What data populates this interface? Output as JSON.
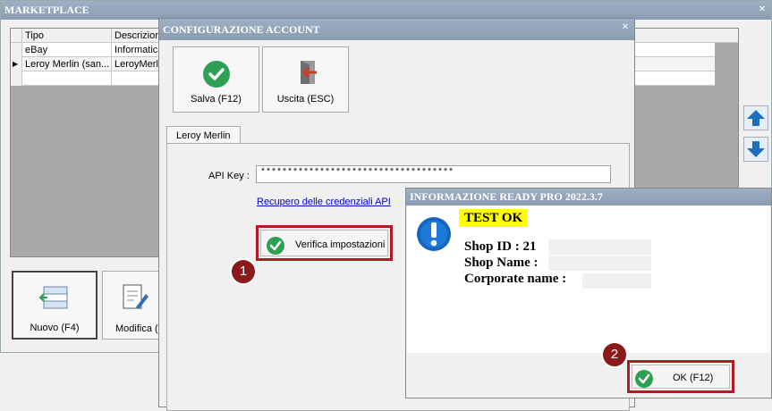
{
  "marketplace": {
    "title": "MARKETPLACE",
    "close": "×",
    "columns": [
      "Tipo",
      "Descrizione"
    ],
    "rows": [
      {
        "tipo": "eBay",
        "desc": "Informatica"
      },
      {
        "tipo": "Leroy Merlin (san...",
        "desc": "LeroyMerlin"
      }
    ],
    "row_indicator": "▶",
    "toolbar": {
      "new_label": "Nuovo (F4)",
      "edit_label": "Modifica (F"
    }
  },
  "config": {
    "title": "CONFIGURAZIONE ACCOUNT",
    "close": "×",
    "save_label": "Salva (F12)",
    "exit_label": "Uscita (ESC)",
    "tab_label": "Leroy Merlin",
    "api_key_label": "API Key :",
    "api_key_value": "************************************",
    "recover_link": "Recupero delle credenziali API",
    "verify_label": "Verifica impostazioni"
  },
  "info": {
    "title": "INFORMAZIONE READY PRO 2022.3.7",
    "test_result": "TEST OK",
    "shop_id": "Shop ID : 21",
    "shop_name": "Shop Name :",
    "corporate_name": "Corporate name :",
    "ok_label": "OK (F12)"
  },
  "badges": {
    "one": "1",
    "two": "2"
  },
  "colors": {
    "title_bar": "#8b9cb2",
    "highlight_border": "#b01c24",
    "badge": "#8b1a1a",
    "test_ok_bg": "#ffff00",
    "check_green": "#2ea053",
    "info_blue": "#1565c0",
    "link": "#0000d0"
  }
}
